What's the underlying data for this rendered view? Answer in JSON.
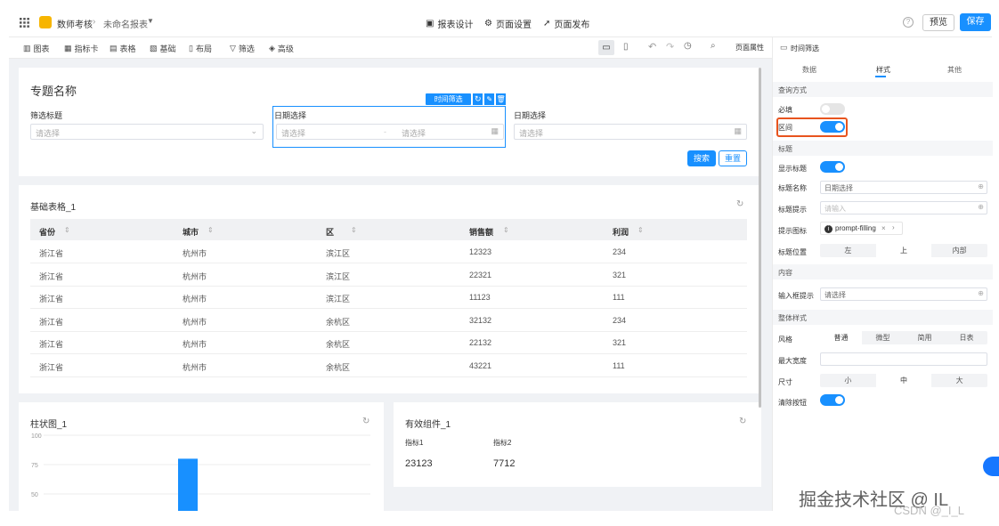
{
  "topbar": {
    "breadcrumb_root": "数师考核",
    "breadcrumb_current": "未命名报表",
    "tabs": [
      "报表设计",
      "页面设置",
      "页面发布"
    ],
    "preview_label": "预览",
    "save_label": "保存"
  },
  "toolbar": {
    "items": [
      "图表",
      "指标卡",
      "表格",
      "基础",
      "布局",
      "筛选",
      "高级"
    ],
    "page_props": "页面属性"
  },
  "filter_card": {
    "title": "专题名称",
    "field1_label": "筛选标题",
    "field1_placeholder": "请选择",
    "field2_label": "日期选择",
    "field2_start": "请选择",
    "field2_end": "请选择",
    "field3_label": "日期选择",
    "field3_placeholder": "请选择",
    "selected_tag": "时间筛选",
    "search_label": "搜索",
    "reset_label": "重置"
  },
  "table_card": {
    "title": "基础表格_1",
    "headers": [
      "省份",
      "城市",
      "区",
      "销售额",
      "利润"
    ],
    "rows": [
      [
        "浙江省",
        "杭州市",
        "滨江区",
        "12323",
        "234"
      ],
      [
        "浙江省",
        "杭州市",
        "滨江区",
        "22321",
        "321"
      ],
      [
        "浙江省",
        "杭州市",
        "滨江区",
        "11123",
        "111"
      ],
      [
        "浙江省",
        "杭州市",
        "余杭区",
        "32132",
        "234"
      ],
      [
        "浙江省",
        "杭州市",
        "余杭区",
        "22132",
        "321"
      ],
      [
        "浙江省",
        "杭州市",
        "余杭区",
        "43221",
        "111"
      ]
    ]
  },
  "bar_card": {
    "title": "柱状图_1"
  },
  "chart_data": {
    "type": "bar",
    "ylim": [
      0,
      100
    ],
    "yticks": [
      "100",
      "75",
      "50"
    ],
    "bar_top_value": 80,
    "color": "#1890ff"
  },
  "kpi_card": {
    "title": "有效组件_1",
    "metric1_label": "指标1",
    "metric1_value": "23123",
    "metric2_label": "指标2",
    "metric2_value": "7712"
  },
  "panel": {
    "header": "时间筛选",
    "tabs": [
      "数据",
      "样式",
      "其他"
    ],
    "sec_query": "查询方式",
    "required_label": "必填",
    "range_label": "区间",
    "sec_title": "标题",
    "show_title_label": "显示标题",
    "title_name_label": "标题名称",
    "title_name_value": "日期选择",
    "title_hint_label": "标题提示",
    "title_hint_value": "请输入",
    "hint_icon_label": "提示图标",
    "hint_icon_value": "prompt-filling",
    "title_pos_label": "标题位置",
    "title_pos_options": [
      "左",
      "上",
      "内部"
    ],
    "sec_content": "内容",
    "input_hint_label": "输入框提示",
    "input_hint_value": "请选择",
    "sec_overall": "整体样式",
    "style_label": "风格",
    "style_options": [
      "普通",
      "微型",
      "简用",
      "日表"
    ],
    "max_width_label": "最大宽度",
    "size_label": "尺寸",
    "size_options": [
      "小",
      "中",
      "大"
    ],
    "clear_btn_label": "清除按钮"
  },
  "watermark": {
    "line1": "掘金技术社区 @ IL",
    "line2": "CSDN @_I_L"
  }
}
